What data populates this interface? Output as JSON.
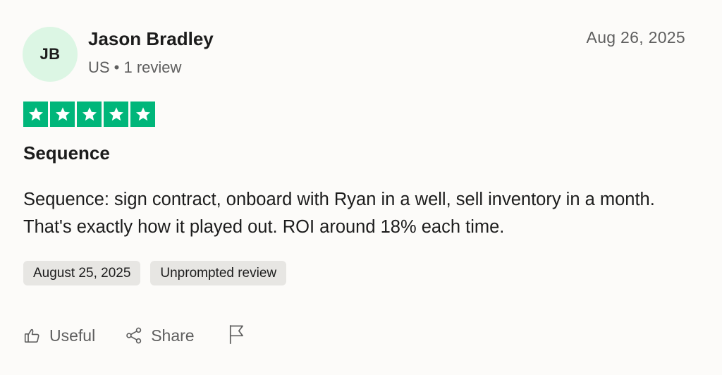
{
  "reviewer": {
    "initials": "JB",
    "name": "Jason Bradley",
    "meta": "US • 1 review"
  },
  "review": {
    "date": "Aug 26, 2025",
    "rating": 5,
    "rating_max": 5,
    "star_color": "#00b67a",
    "title": "Sequence",
    "body": "Sequence: sign contract, onboard with Ryan in a well, sell inventory in a month. That's exactly how it played out. ROI around 18% each time.",
    "tags": [
      "August 25, 2025",
      "Unprompted review"
    ]
  },
  "actions": {
    "useful_label": "Useful",
    "useful_icon": "thumbs-up-icon",
    "share_label": "Share",
    "share_icon": "share-icon",
    "flag_icon": "flag-icon"
  }
}
